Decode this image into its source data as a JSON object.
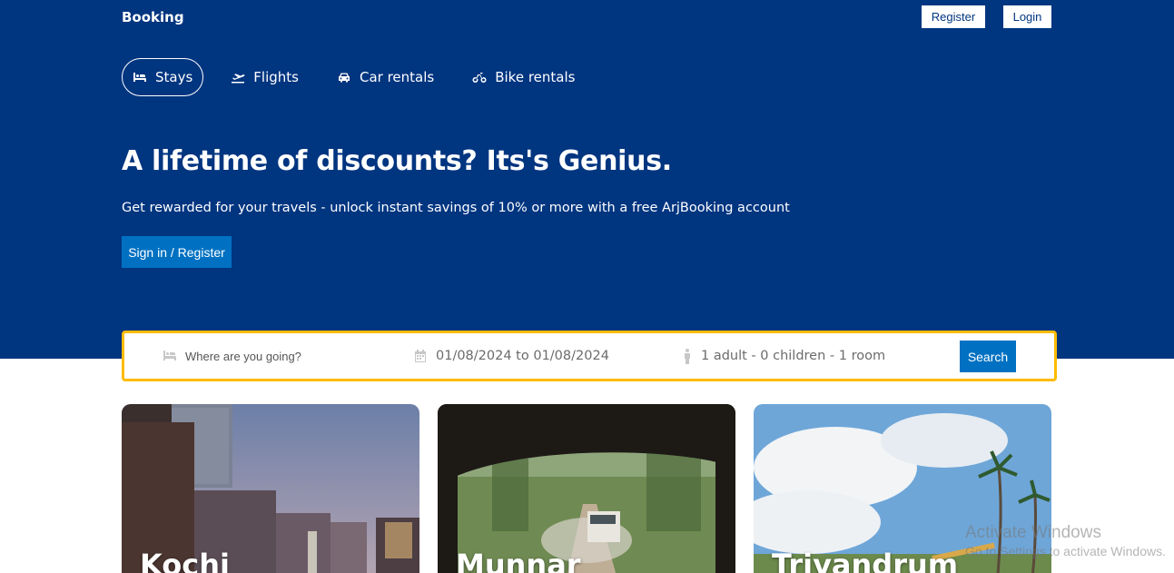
{
  "header": {
    "logo": "Booking",
    "register_label": "Register",
    "login_label": "Login"
  },
  "nav": {
    "items": [
      {
        "label": "Stays",
        "icon": "bed-icon",
        "active": true
      },
      {
        "label": "Flights",
        "icon": "plane-icon",
        "active": false
      },
      {
        "label": "Car rentals",
        "icon": "car-icon",
        "active": false
      },
      {
        "label": "Bike rentals",
        "icon": "bike-icon",
        "active": false
      }
    ]
  },
  "hero": {
    "title": "A lifetime of discounts? Its's Genius.",
    "description": "Get rewarded for your travels - unlock instant savings of 10% or more with a free ArjBooking account",
    "signin_label": "Sign in / Register"
  },
  "search": {
    "destination_placeholder": "Where are you going?",
    "date_range": "01/08/2024 to 01/08/2024",
    "options": "1 adult - 0 children - 1 room",
    "search_label": "Search"
  },
  "cards": [
    {
      "title": "Kochi"
    },
    {
      "title": "Munnar"
    },
    {
      "title": "Trivandrum"
    }
  ],
  "watermark": {
    "title": "Activate Windows",
    "subtitle": "Go to Settings to activate Windows."
  },
  "colors": {
    "primary": "#003580",
    "accent": "#0071c2",
    "search_border": "#febb02"
  }
}
